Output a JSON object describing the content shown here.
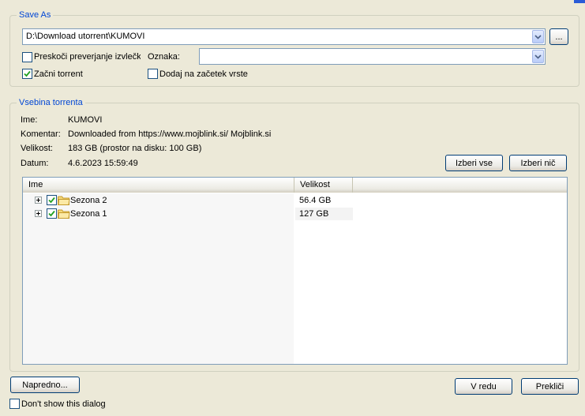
{
  "save_as": {
    "title": "Save As",
    "path": "D:\\Download utorrent\\KUMOVI",
    "browse_label": "...",
    "skip_hash_check_label": "Preskoči preverjanje izvlečka",
    "skip_hash_check_checked": false,
    "label_caption": "Oznaka:",
    "label_value": "",
    "start_torrent_label": "Začni torrent",
    "start_torrent_checked": true,
    "add_to_top_label": "Dodaj na začetek vrste",
    "add_to_top_checked": false
  },
  "contents": {
    "title": "Vsebina torrenta",
    "name_caption": "Ime:",
    "name_value": "KUMOVI",
    "comment_caption": "Komentar:",
    "comment_value": "Downloaded from https://www.mojblink.si/ Mojblink.si",
    "size_caption": "Velikost:",
    "size_value": "183 GB (prostor na disku: 100 GB)",
    "date_caption": "Datum:",
    "date_value": "4.6.2023 15:59:49",
    "select_all_label": "Izberi vse",
    "select_none_label": "Izberi nič",
    "columns": [
      "Ime",
      "Velikost"
    ],
    "files": [
      {
        "name": "Sezona 2",
        "size": "56.4 GB",
        "checked": true
      },
      {
        "name": "Sezona 1",
        "size": "127 GB",
        "checked": true
      }
    ]
  },
  "footer": {
    "advanced_label": "Napredno...",
    "ok_label": "V redu",
    "cancel_label": "Prekliči",
    "dont_show_label": "Don't show this dialog",
    "dont_show_checked": false
  },
  "colors": {
    "background": "#ECE9D8",
    "group_title": "#0046D5",
    "button_border": "#003C74"
  }
}
